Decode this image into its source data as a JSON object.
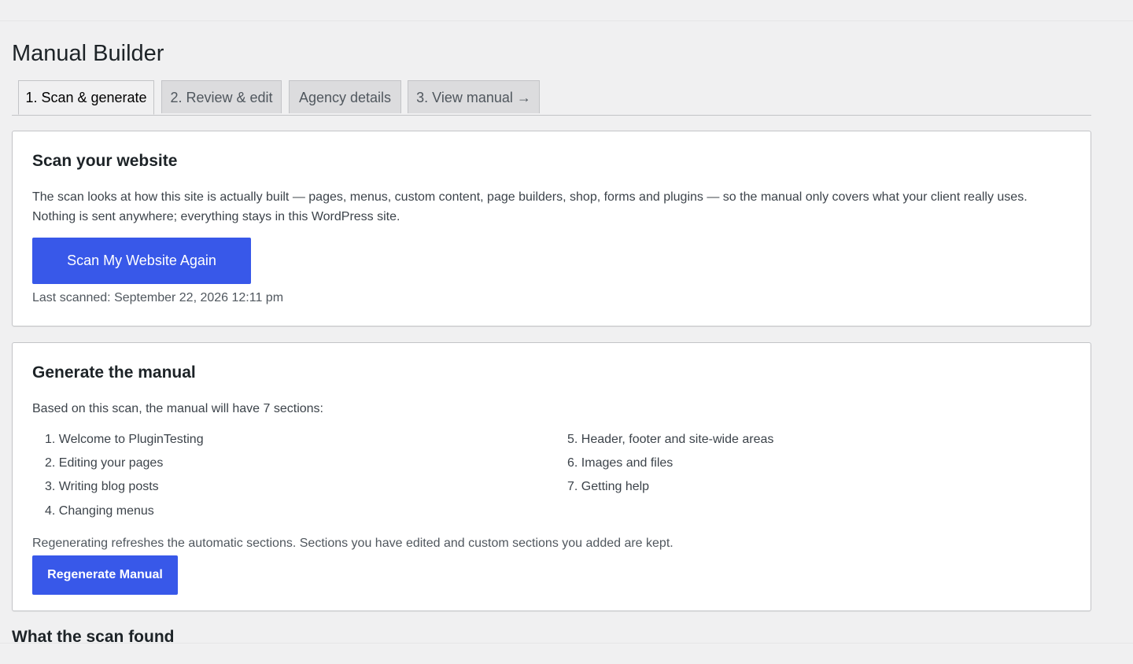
{
  "page": {
    "title": "Manual Builder"
  },
  "tabs": [
    {
      "label": "1. Scan & generate",
      "active": true
    },
    {
      "label": "2. Review & edit",
      "active": false
    },
    {
      "label": "Agency details",
      "active": false
    },
    {
      "label": "3. View manual →",
      "active": false
    }
  ],
  "scan_card": {
    "heading": "Scan your website",
    "description_line1": "The scan looks at how this site is actually built — pages, menus, custom content, page builders, shop, forms and plugins — so the manual only covers what your client really uses.",
    "description_line2": "Nothing is sent anywhere; everything stays in this WordPress site.",
    "button_label": "Scan My Website Again",
    "last_scanned": "Last scanned: September 22, 2026 12:11 pm"
  },
  "generate_card": {
    "heading": "Generate the manual",
    "intro": "Based on this scan, the manual will have 7 sections:",
    "sections": [
      "1. Welcome to PluginTesting",
      "2. Editing your pages",
      "3. Writing blog posts",
      "4. Changing menus",
      "5. Header, footer and site-wide areas",
      "6. Images and files",
      "7. Getting help"
    ],
    "note": "Regenerating refreshes the automatic sections. Sections you have edited and custom sections you added are kept.",
    "button_label": "Regenerate Manual"
  },
  "found": {
    "heading": "What the scan found"
  },
  "colors": {
    "accent": "#3858e9",
    "background": "#f0f0f1"
  }
}
